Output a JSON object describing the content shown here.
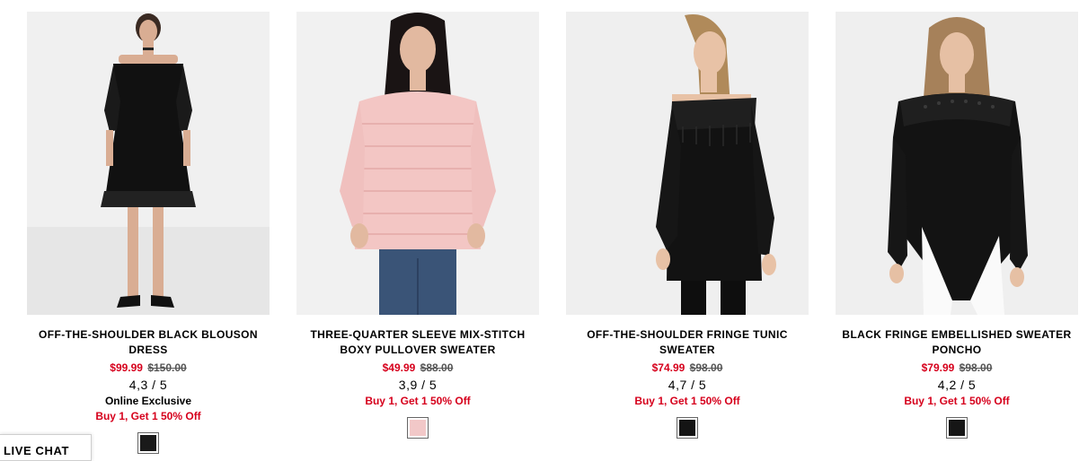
{
  "products": [
    {
      "name": "OFF-THE-SHOULDER BLACK BLOUSON DRESS",
      "sale_price": "$99.99",
      "original_price": "$150.00",
      "rating": "4,3 / 5",
      "badge": "Online Exclusive",
      "promo": "Buy 1, Get 1 50% Off",
      "swatch_color": "#1a1a1a",
      "image": "model-black-off-shoulder-lace-dress"
    },
    {
      "name": "THREE-QUARTER SLEEVE MIX-STITCH BOXY PULLOVER SWEATER",
      "sale_price": "$49.99",
      "original_price": "$88.00",
      "rating": "3,9 / 5",
      "badge": "",
      "promo": "Buy 1, Get 1 50% Off",
      "swatch_color": "#f2c8c8",
      "image": "model-pink-pullover-sweater-jeans"
    },
    {
      "name": "OFF-THE-SHOULDER FRINGE TUNIC SWEATER",
      "sale_price": "$74.99",
      "original_price": "$98.00",
      "rating": "4,7 / 5",
      "badge": "",
      "promo": "Buy 1, Get 1 50% Off",
      "swatch_color": "#141414",
      "image": "model-black-fringe-tunic-sweater"
    },
    {
      "name": "BLACK FRINGE EMBELLISHED SWEATER PONCHO",
      "sale_price": "$79.99",
      "original_price": "$98.00",
      "rating": "4,2 / 5",
      "badge": "",
      "promo": "Buy 1, Get 1 50% Off",
      "swatch_color": "#161616",
      "image": "model-black-fringe-poncho"
    }
  ],
  "live_chat": {
    "label": "LIVE CHAT"
  },
  "colors": {
    "sale_red": "#d6001c",
    "photo_bg": "#ececec"
  }
}
